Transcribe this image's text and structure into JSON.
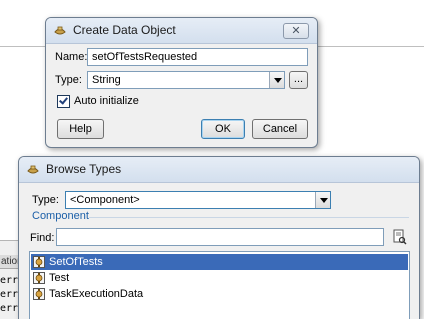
{
  "create_dialog": {
    "title": "Create Data Object",
    "close_label": "✕",
    "name_label": "Name:",
    "name_value": "setOfTestsRequested",
    "type_label": "Type:",
    "type_value": "String",
    "browse_label": "...",
    "auto_init_label": "Auto initialize",
    "auto_init_checked": true,
    "help_label": "Help",
    "ok_label": "OK",
    "cancel_label": "Cancel"
  },
  "browse_dialog": {
    "title": "Browse Types",
    "type_label": "Type:",
    "type_value": "<Component>",
    "group_label": "Component",
    "find_label": "Find:",
    "find_value": "",
    "items": [
      {
        "label": "SetOfTests",
        "selected": true
      },
      {
        "label": "Test",
        "selected": false
      },
      {
        "label": "TaskExecutionData",
        "selected": false
      }
    ]
  },
  "background": {
    "header_text": "ation",
    "rows": [
      "err",
      "err",
      "err"
    ]
  },
  "colors": {
    "selection": "#3a6ab8",
    "group_label": "#1b5fa8",
    "titlebar": "#d3dfee"
  }
}
